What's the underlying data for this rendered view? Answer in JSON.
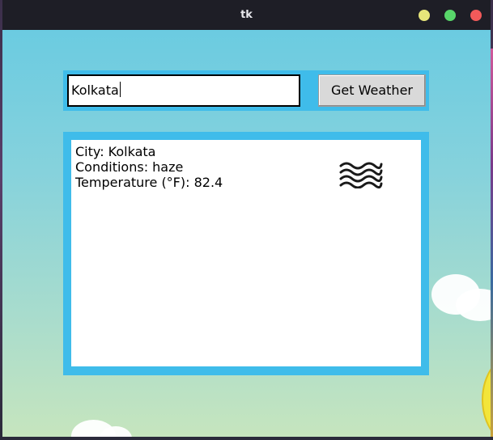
{
  "window": {
    "title": "tk"
  },
  "search": {
    "city_value": "Kolkata",
    "button_label": "Get Weather"
  },
  "result": {
    "city_line": "City: Kolkata",
    "conditions_line": "Conditions: haze",
    "temperature_line": "Temperature (°F): 82.4",
    "weather_icon": "haze-icon"
  },
  "colors": {
    "frame_accent": "#3fbcea",
    "titlebar": "#1e1e26",
    "minimize": "#e6e57a",
    "maximize": "#58d66a",
    "close": "#f25a5a"
  }
}
